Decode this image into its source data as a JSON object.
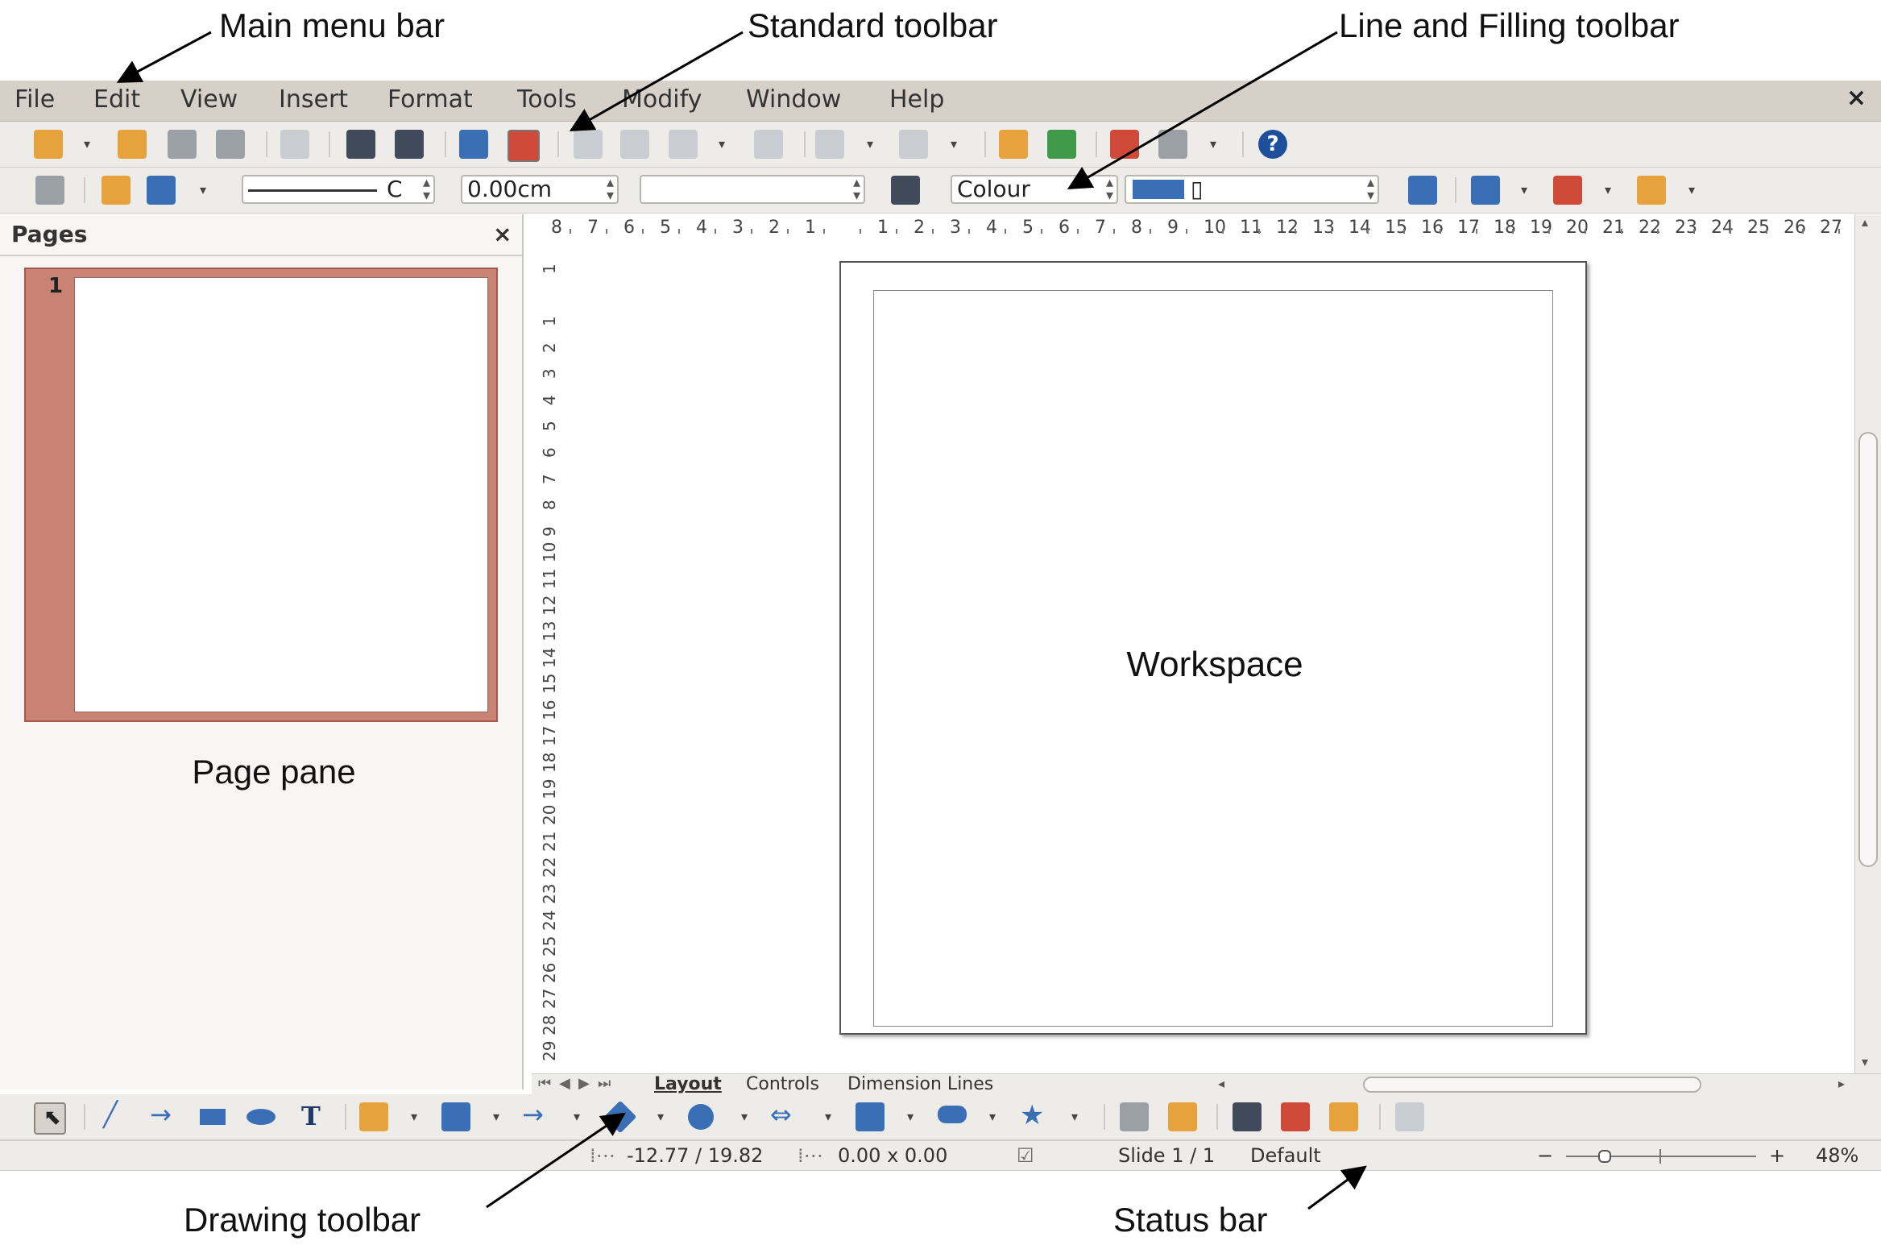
{
  "callouts": {
    "main_menu_bar": "Main menu bar",
    "standard_toolbar": "Standard toolbar",
    "line_filling_toolbar": "Line and Filling toolbar",
    "drawing_toolbar": "Drawing toolbar",
    "status_bar": "Status bar",
    "page_pane": "Page pane",
    "workspace": "Workspace"
  },
  "menu": {
    "file": "File",
    "edit": "Edit",
    "view": "View",
    "insert": "Insert",
    "format": "Format",
    "tools": "Tools",
    "modify": "Modify",
    "window": "Window",
    "help": "Help",
    "close": "×"
  },
  "line_toolbar": {
    "line_style_value": "C",
    "line_width_value": "0.00cm",
    "line_color_value": "",
    "area_style_value": "Colour",
    "area_fill_value": "▯"
  },
  "pages_pane": {
    "title": "Pages",
    "close": "×",
    "thumb_number": "1"
  },
  "rulers": {
    "horizontal_labels": [
      "8",
      "7",
      "6",
      "5",
      "4",
      "3",
      "2",
      "1",
      "",
      "1",
      "2",
      "3",
      "4",
      "5",
      "6",
      "7",
      "8",
      "9",
      "10",
      "11",
      "12",
      "13",
      "14",
      "15",
      "16",
      "17",
      "18",
      "19",
      "20",
      "21",
      "22",
      "23",
      "24",
      "25",
      "26",
      "27"
    ],
    "vertical_labels": [
      "1",
      "",
      "1",
      "2",
      "3",
      "4",
      "5",
      "6",
      "7",
      "8",
      "9",
      "10",
      "11",
      "12",
      "13",
      "14",
      "15",
      "16",
      "17",
      "18",
      "19",
      "20",
      "21",
      "22",
      "23",
      "24",
      "25",
      "26",
      "27",
      "28",
      "29"
    ]
  },
  "tabs": {
    "layout": "Layout",
    "controls": "Controls",
    "dimension_lines": "Dimension Lines"
  },
  "status": {
    "position": "-12.77 / 19.82",
    "size": "0.00 x 0.00",
    "slide": "Slide 1 / 1",
    "layout": "Default",
    "zoom": "48%",
    "zoom_minus": "−",
    "zoom_plus": "+"
  },
  "colors": {
    "menubar_bg": "#d6d0c8",
    "toolbar_bg": "#eeece9",
    "thumb_frame": "#c98274",
    "fill_color": "#3a6fb5"
  }
}
